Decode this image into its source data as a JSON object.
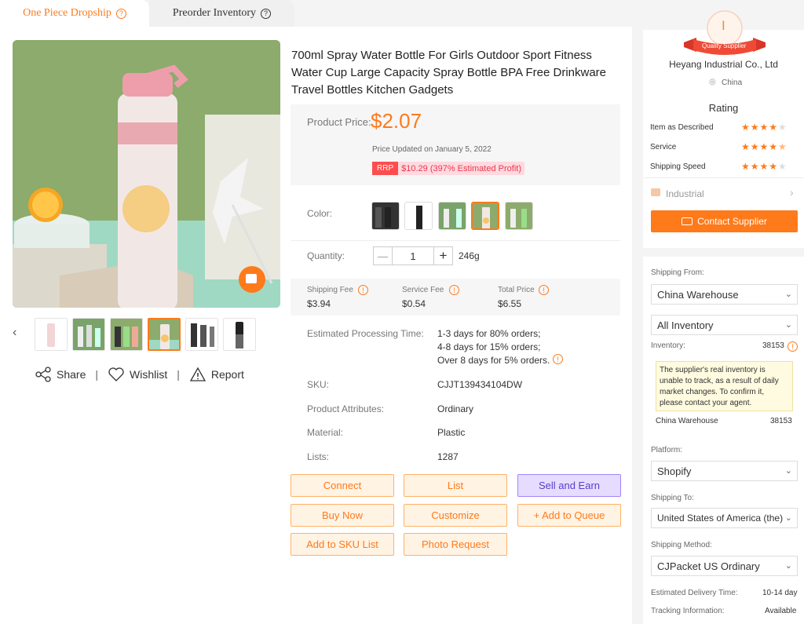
{
  "tabs": [
    {
      "label": "One Piece Dropship",
      "active": true
    },
    {
      "label": "Preorder Inventory",
      "active": false
    }
  ],
  "product": {
    "title": "700ml Spray Water Bottle For Girls Outdoor Sport Fitness Water Cup Large Capacity Spray Bottle BPA Free Drinkware Travel Bottles Kitchen Gadgets",
    "price_label": "Product Price:",
    "price": "$2.07",
    "price_updated": "Price Updated on January 5, 2022",
    "rrp_badge": "RRP",
    "rrp_text": "$10.29 (397% Estimated Profit)",
    "color_label": "Color:",
    "quantity_label": "Quantity:",
    "quantity_value": "1",
    "minus": "—",
    "plus": "+",
    "weight": "246g",
    "shipping_fee_label": "Shipping Fee",
    "shipping_fee": "$3.94",
    "service_fee_label": "Service Fee",
    "service_fee": "$0.54",
    "total_price_label": "Total Price",
    "total_price": "$6.55",
    "processing_label": "Estimated Processing Time:",
    "processing": [
      "1-3 days for 80% orders;",
      "4-8 days for 15% orders;",
      "Over 8 days for 5% orders."
    ],
    "attrs": [
      {
        "label": "SKU:",
        "value": "CJJT139434104DW"
      },
      {
        "label": "Product Attributes:",
        "value": "Ordinary"
      },
      {
        "label": "Material:",
        "value": "Plastic"
      },
      {
        "label": "Lists:",
        "value": "1287"
      }
    ]
  },
  "gallery": {
    "share": "Share",
    "wishlist": "Wishlist",
    "report": "Report",
    "sep": "|"
  },
  "buttons": {
    "connect": "Connect",
    "list": "List",
    "sell_earn": "Sell and Earn",
    "buy_now": "Buy Now",
    "customize": "Customize",
    "add_queue": "+ Add to Queue",
    "add_sku": "Add to SKU List",
    "photo_request": "Photo Request"
  },
  "supplier": {
    "badge": "Quality Supplier",
    "badge_letter": "I",
    "name": "Heyang Industrial Co., Ltd",
    "country": "China",
    "rating_title": "Rating",
    "ratings": [
      {
        "label": "Item as Described",
        "stars": 4
      },
      {
        "label": "Service",
        "stars": 4.5
      },
      {
        "label": "Shipping Speed",
        "stars": 4
      }
    ],
    "category": "Industrial",
    "contact_button": "Contact Supplier"
  },
  "shipping": {
    "from_label": "Shipping From:",
    "from_value": "China Warehouse",
    "inventory_select": "All Inventory",
    "inventory_label": "Inventory:",
    "inventory_value": "38153",
    "note": "The supplier's real inventory is unable to track, as a result of daily market changes. To confirm it, please contact your agent.",
    "warehouse_label": "China Warehouse",
    "warehouse_value": "38153",
    "platform_label": "Platform:",
    "platform_value": "Shopify",
    "to_label": "Shipping To:",
    "to_value": "United States of America (the)",
    "method_label": "Shipping Method:",
    "method_value": "CJPacket US Ordinary",
    "delivery_label": "Estimated Delivery Time:",
    "delivery_value": "10-14 day",
    "tracking_label": "Tracking Information:",
    "tracking_value": "Available"
  },
  "colors": {
    "accent": "#ff7a1a",
    "rrp_bg": "#ffd9e0",
    "rrp_badge": "#ff4d4f",
    "purple": "#e6dcff"
  }
}
